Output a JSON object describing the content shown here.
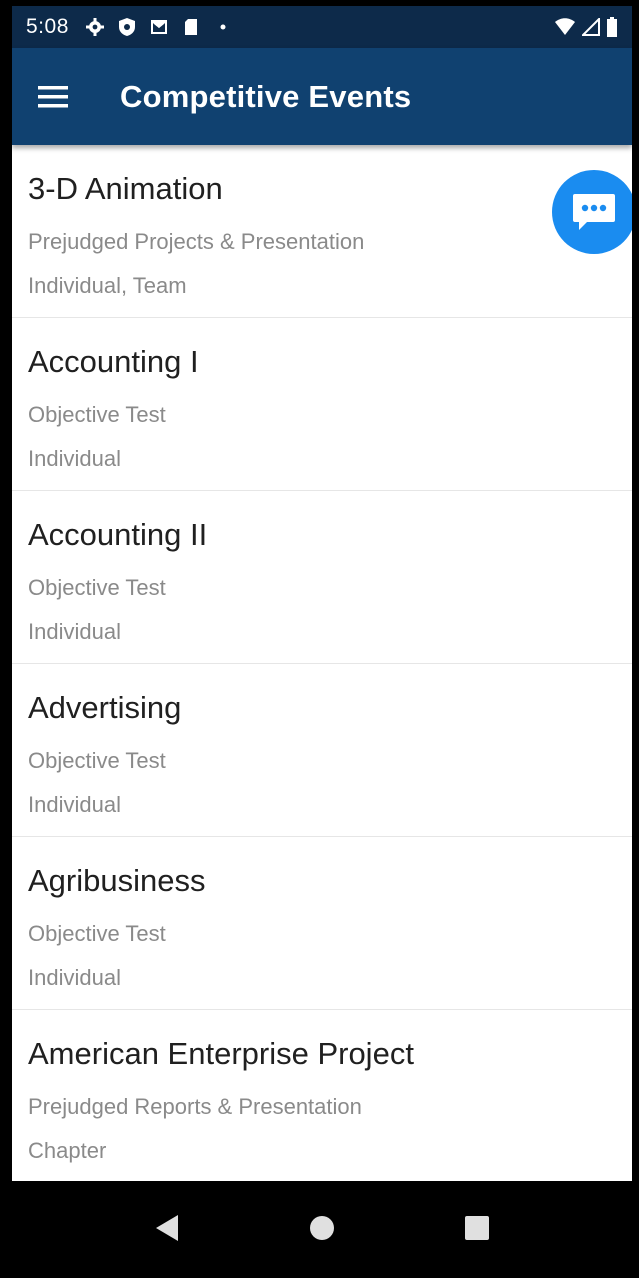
{
  "status_bar": {
    "time": "5:08",
    "left_icons": [
      "gear-icon",
      "shield-icon",
      "mail-icon",
      "sd-card-icon",
      "dot-icon"
    ],
    "right_icons": [
      "wifi-icon",
      "signal-icon",
      "battery-icon"
    ]
  },
  "app_bar": {
    "title": "Competitive Events",
    "menu_icon": "hamburger-menu-icon",
    "background": "#104170"
  },
  "events": [
    {
      "title": "3-D Animation",
      "type": "Prejudged Projects & Presentation",
      "participants": "Individual, Team"
    },
    {
      "title": "Accounting I",
      "type": "Objective Test",
      "participants": "Individual"
    },
    {
      "title": "Accounting II",
      "type": "Objective Test",
      "participants": "Individual"
    },
    {
      "title": "Advertising",
      "type": "Objective Test",
      "participants": "Individual"
    },
    {
      "title": "Agribusiness",
      "type": "Objective Test",
      "participants": "Individual"
    },
    {
      "title": "American Enterprise Project",
      "type": "Prejudged Reports & Presentation",
      "participants": "Chapter"
    }
  ],
  "chat_button": {
    "icon": "chat-bubble-icon",
    "color": "#1a8cf0"
  },
  "nav_bar": {
    "buttons": [
      "back-icon",
      "home-icon",
      "recents-icon"
    ]
  }
}
